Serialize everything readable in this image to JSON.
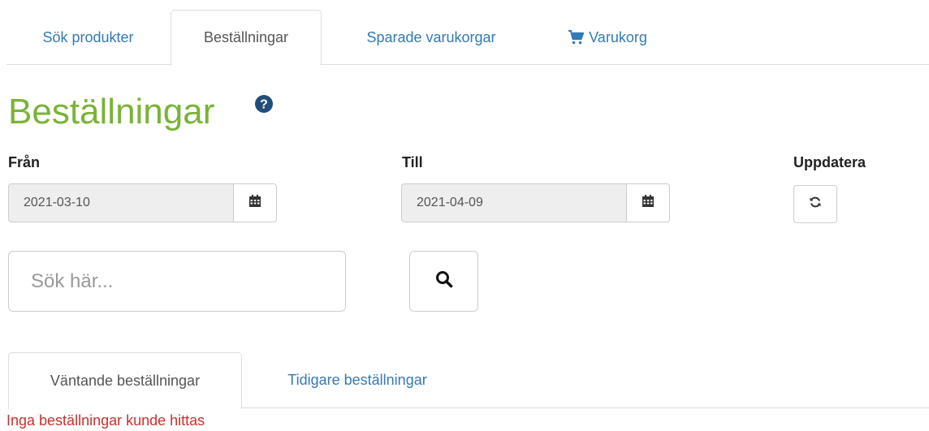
{
  "nav": {
    "tabs": [
      {
        "label": "Sök produkter",
        "active": false
      },
      {
        "label": "Beställningar",
        "active": true
      },
      {
        "label": "Sparade varukorgar",
        "active": false
      },
      {
        "label": "Varukorg",
        "active": false,
        "icon": "shopping-cart-icon"
      }
    ]
  },
  "page": {
    "title": "Beställningar",
    "title_color": "#7ab338",
    "help_icon": "question-circle-icon"
  },
  "filters": {
    "from": {
      "label": "Från",
      "value": "2021-03-10",
      "icon": "calendar-icon"
    },
    "to": {
      "label": "Till",
      "value": "2021-04-09",
      "icon": "calendar-icon"
    },
    "refresh": {
      "label": "Uppdatera",
      "icon": "refresh-icon"
    }
  },
  "search": {
    "placeholder": "Sök här...",
    "icon": "search-icon"
  },
  "order_tabs": [
    {
      "label": "Väntande beställningar",
      "active": true
    },
    {
      "label": "Tidigare beställningar",
      "active": false
    }
  ],
  "empty_message": "Inga beställningar kunde hittas",
  "colors": {
    "link": "#337ab7",
    "error": "#c9302c"
  }
}
